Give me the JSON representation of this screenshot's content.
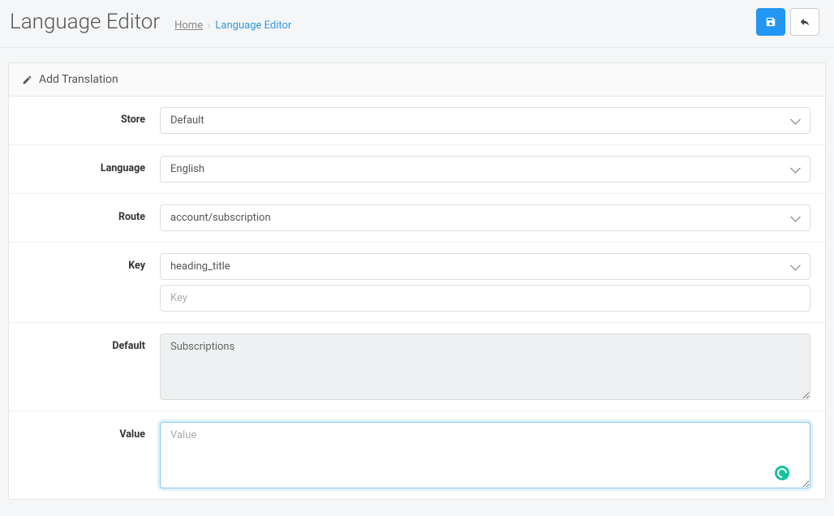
{
  "header": {
    "title": "Language Editor",
    "breadcrumb": {
      "home": "Home",
      "current": "Language Editor"
    }
  },
  "panel": {
    "title": "Add Translation"
  },
  "form": {
    "store": {
      "label": "Store",
      "value": "Default"
    },
    "language": {
      "label": "Language",
      "value": "English"
    },
    "route": {
      "label": "Route",
      "value": "account/subscription"
    },
    "key": {
      "label": "Key",
      "select_value": "heading_title",
      "input_placeholder": "Key",
      "input_value": ""
    },
    "default": {
      "label": "Default",
      "value": "Subscriptions"
    },
    "value": {
      "label": "Value",
      "placeholder": "Value",
      "value": ""
    }
  }
}
